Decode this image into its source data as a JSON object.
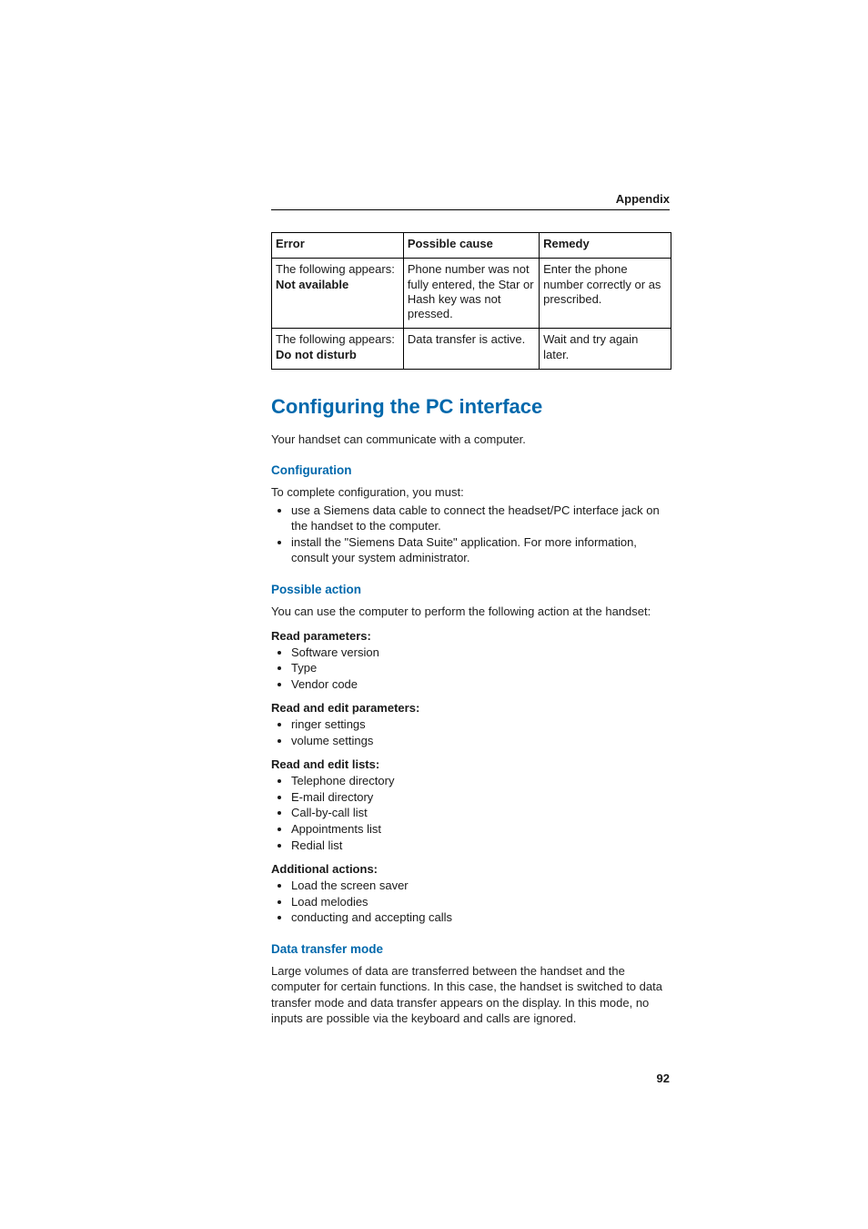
{
  "running_head": "Appendix",
  "page_number": "92",
  "table": {
    "headers": [
      "Error",
      "Possible cause",
      "Remedy"
    ],
    "rows": [
      {
        "error_pre": "The following appears: ",
        "error_bold": "Not available",
        "cause": "Phone number was not fully entered, the Star or Hash key was not pressed.",
        "remedy": "Enter the phone number correctly or as prescribed."
      },
      {
        "error_pre": "The following appears: ",
        "error_bold": "Do not disturb",
        "cause": "Data transfer is active.",
        "remedy": "Wait and try again later."
      }
    ]
  },
  "section": {
    "title": "Configuring the PC interface",
    "intro": "Your handset can communicate with a computer.",
    "configuration": {
      "heading": "Configuration",
      "lead": "To complete configuration, you must:",
      "items": [
        "use a Siemens data cable to connect the headset/PC interface jack on the handset to the computer.",
        "install the \"Siemens Data Suite\" application. For more information, consult your system administrator."
      ]
    },
    "possible_action": {
      "heading": "Possible action",
      "lead": "You can use the computer to perform the following action at the handset:",
      "groups": [
        {
          "title": "Read parameters:",
          "items": [
            "Software version",
            "Type",
            "Vendor code"
          ]
        },
        {
          "title": "Read and edit parameters:",
          "items": [
            "ringer settings",
            "volume settings"
          ]
        },
        {
          "title": "Read and edit lists:",
          "items": [
            "Telephone directory",
            "E-mail directory",
            "Call-by-call list",
            "Appointments list",
            "Redial list"
          ]
        },
        {
          "title": "Additional actions:",
          "items": [
            "Load the screen saver",
            "Load melodies",
            "conducting and accepting calls"
          ]
        }
      ]
    },
    "data_transfer": {
      "heading": "Data transfer mode",
      "body": "Large volumes of data are transferred between the handset and the computer for certain functions. In this case, the handset is switched to data transfer mode and data transfer appears on the display. In this mode, no inputs are possible via the keyboard and calls are ignored."
    }
  }
}
